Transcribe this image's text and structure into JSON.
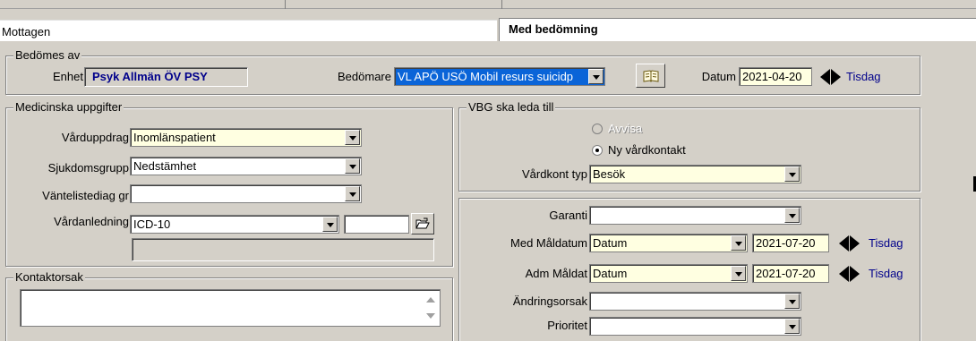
{
  "tabs": {
    "left_label": "Mottagen",
    "active_label": "Med bedömning"
  },
  "bedomes_av": {
    "legend": "Bedömes av",
    "enhet_label": "Enhet",
    "enhet_value": "Psyk Allmän ÖV PSY",
    "bedomare_label": "Bedömare",
    "bedomare_value": "VL APÖ USÖ Mobil resurs suicidp",
    "datum_label": "Datum",
    "datum_value": "2021-04-20",
    "day": "Tisdag",
    "book_icon": "book-icon"
  },
  "medicinska": {
    "legend": "Medicinska uppgifter",
    "varduppdrag_label": "Vårduppdrag",
    "varduppdrag_value": "Inomlänspatient",
    "sjukdomsgrupp_label": "Sjukdomsgrupp",
    "sjukdomsgrupp_value": "Nedstämhet",
    "vantelistediag_label": "Väntelistediag gr",
    "vantelistediag_value": "",
    "vardanledning_label": "Vårdanledning",
    "vardanledning_value": "ICD-10",
    "vardanledning_code": "",
    "open_icon": "open-folder-icon"
  },
  "vbg": {
    "legend": "VBG ska leda till",
    "option_avvisa": "Avvisa",
    "option_ny": "Ny vårdkontakt",
    "selected": "Ny vårdkontakt",
    "vardkont_typ_label": "Vårdkont typ",
    "vardkont_typ_value": "Besök"
  },
  "garanti": {
    "garanti_label": "Garanti",
    "garanti_value": "",
    "med_maldatum_label": "Med Måldatum",
    "med_maldatum_type": "Datum",
    "med_maldatum_date": "2021-07-20",
    "med_maldatum_day": "Tisdag",
    "adm_maldat_label": "Adm Måldat",
    "adm_maldat_type": "Datum",
    "adm_maldat_date": "2021-07-20",
    "adm_maldat_day": "Tisdag",
    "andringsorsak_label": "Ändringsorsak",
    "andringsorsak_value": "",
    "prioritet_label": "Prioritet",
    "prioritet_value": ""
  },
  "kontaktorsak": {
    "legend": "Kontaktorsak",
    "value": ""
  },
  "colors": {
    "background": "#d4d0c8",
    "field_yellow": "#ffffe1",
    "selection_blue": "#0a64d8",
    "day_text": "#00008b"
  }
}
